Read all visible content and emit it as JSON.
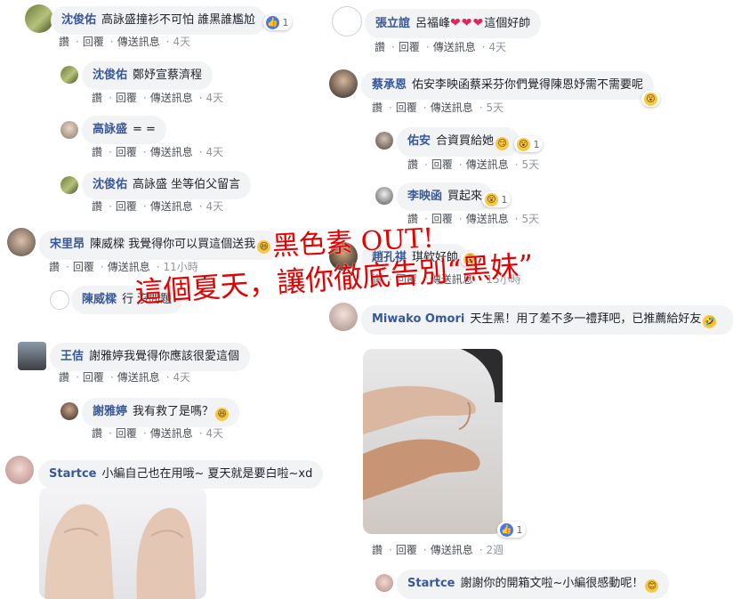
{
  "overlay": {
    "line1": "黑色素 OUT!",
    "line2": "這個夏天，讓你徹底告別“黑妹”"
  },
  "actions": {
    "like": "讚",
    "reply": "回覆",
    "message": "傳送訊息"
  },
  "left": {
    "c1": {
      "name": "沈俊佑",
      "text": "高詠盛撞衫不可怕 誰黑誰尷尬",
      "react_count": "1",
      "time": "4天"
    },
    "c1r1": {
      "name": "沈俊佑",
      "text": "鄭妤宣蔡濟程",
      "time": "4天"
    },
    "c1r2": {
      "name": "高詠盛",
      "text": "= =",
      "time": "4天"
    },
    "c1r3": {
      "name": "沈俊佑",
      "text": "高詠盛 坐等伯父留言",
      "time": "4天"
    },
    "c2": {
      "name": "宋里昂",
      "text": "陳威樑 我覺得你可以買這個送我",
      "time": "11小時"
    },
    "c2r1": {
      "name": "陳威樑",
      "text": "行 沒問題"
    },
    "c3": {
      "name": "王佶",
      "text": "謝雅婷我覺得你應該很愛這個",
      "time": "4天"
    },
    "c3r1": {
      "name": "謝雅婷",
      "text": "我有救了是嗎？",
      "time": "4天"
    },
    "c4": {
      "name": "Startce",
      "text": "小編自己也在用哦~ 夏天就是要白啦~xd"
    }
  },
  "right": {
    "c1": {
      "name": "張立誼",
      "text": "呂福峰",
      "text2": "這個好帥",
      "time": "4天"
    },
    "c2": {
      "name": "蔡承恩",
      "text": "佑安李映函蔡采芬你們覺得陳恩妤需不需要呢",
      "time": "5天"
    },
    "c2r1": {
      "name": "佑安",
      "text": "合資買給她",
      "react_count": "1",
      "time": "5天"
    },
    "c2r2": {
      "name": "李映函",
      "text": "買起來",
      "react_count": "1",
      "time": "5天"
    },
    "c3": {
      "name": "趙孔祺",
      "text": "琪欸好帥",
      "time": "15小時"
    },
    "c4": {
      "name": "Miwako Omori",
      "text": "天生黑！用了差不多一禮拜吧，已推薦給好友",
      "react_count": "1",
      "time": "2週"
    },
    "c5": {
      "name": "Startce",
      "text": "謝謝你的開箱文啦~小編很感動呢！"
    }
  },
  "icons": {
    "like": "👍",
    "wow": "😮",
    "haha": "😆",
    "smile": "😊",
    "heart": "❤"
  }
}
